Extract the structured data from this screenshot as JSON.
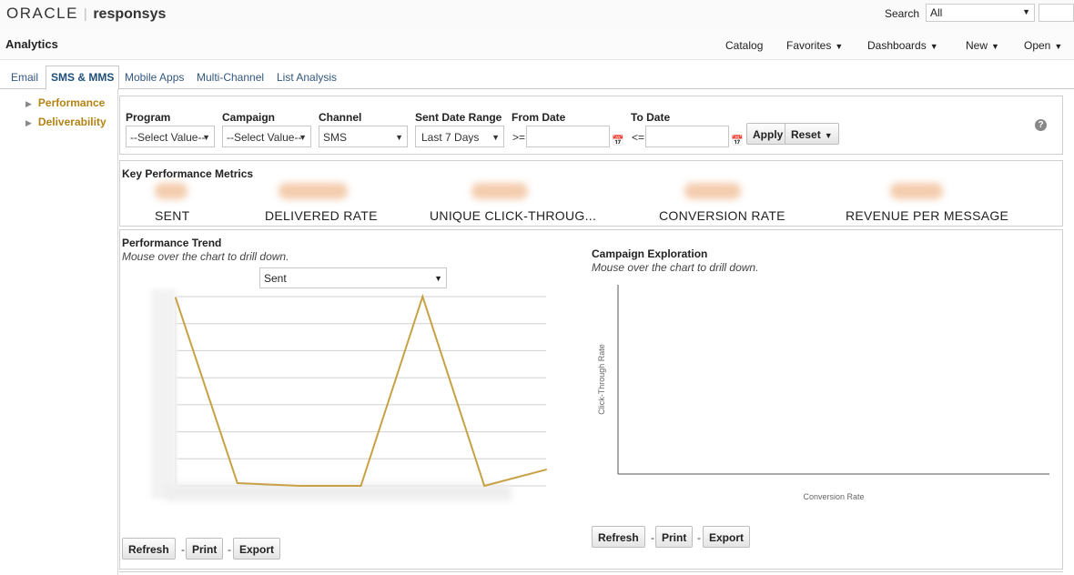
{
  "brand": {
    "oracle": "ORACLE",
    "product": "responsys"
  },
  "search": {
    "label": "Search",
    "scope": "All"
  },
  "header": {
    "title": "Analytics",
    "menus": [
      {
        "label": "Catalog",
        "dropdown": false
      },
      {
        "label": "Favorites",
        "dropdown": true
      },
      {
        "label": "Dashboards",
        "dropdown": true
      },
      {
        "label": "New",
        "dropdown": true
      },
      {
        "label": "Open",
        "dropdown": true
      }
    ]
  },
  "tabs": [
    {
      "label": "Email",
      "active": false
    },
    {
      "label": "SMS & MMS",
      "active": true
    },
    {
      "label": "Mobile Apps",
      "active": false
    },
    {
      "label": "Multi-Channel",
      "active": false
    },
    {
      "label": "List Analysis",
      "active": false
    }
  ],
  "sidebar": {
    "items": [
      {
        "label": "Performance"
      },
      {
        "label": "Deliverability"
      }
    ]
  },
  "filters": {
    "program": {
      "label": "Program",
      "value": "--Select Value--"
    },
    "campaign": {
      "label": "Campaign",
      "value": "--Select Value--"
    },
    "channel": {
      "label": "Channel",
      "value": "SMS"
    },
    "sent_date_range": {
      "label": "Sent Date Range",
      "value": "Last 7 Days"
    },
    "from_date": {
      "label": "From Date",
      "operator": ">=",
      "value": ""
    },
    "to_date": {
      "label": "To Date",
      "operator": "<=",
      "value": ""
    },
    "apply_label": "Apply",
    "reset_label": "Reset",
    "help": "?"
  },
  "kpi": {
    "title": "Key Performance Metrics",
    "metrics": [
      {
        "label": "SENT"
      },
      {
        "label": "DELIVERED RATE"
      },
      {
        "label": "UNIQUE CLICK-THROUG..."
      },
      {
        "label": "CONVERSION RATE"
      },
      {
        "label": "REVENUE PER MESSAGE"
      }
    ]
  },
  "trend": {
    "title": "Performance Trend",
    "subtitle": "Mouse over the chart to drill down.",
    "measure": "Sent",
    "actions": {
      "refresh": "Refresh",
      "print": "Print",
      "export": "Export",
      "sep": "-"
    }
  },
  "exploration": {
    "title": "Campaign Exploration",
    "subtitle": "Mouse over the chart to drill down.",
    "actions": {
      "refresh": "Refresh",
      "print": "Print",
      "export": "Export",
      "sep": "-"
    }
  },
  "colors": {
    "line": "#c8a145",
    "brand_gold": "#b38314",
    "link": "#33577f",
    "grid": "#d0d0d0"
  },
  "chart_data": [
    {
      "type": "line",
      "title": "",
      "xlabel": "",
      "ylabel": "",
      "ylim": [
        0,
        7
      ],
      "x": [
        0,
        1,
        2,
        3,
        4,
        5,
        6
      ],
      "series": [
        {
          "values": [
            6.95,
            0.1,
            0,
            0,
            7,
            0,
            0.6
          ]
        }
      ],
      "grid": true
    },
    {
      "type": "scatter",
      "title": "",
      "xlabel": "Conversion Rate",
      "ylabel": "Click-Through Rate",
      "series": [],
      "grid": false
    }
  ]
}
